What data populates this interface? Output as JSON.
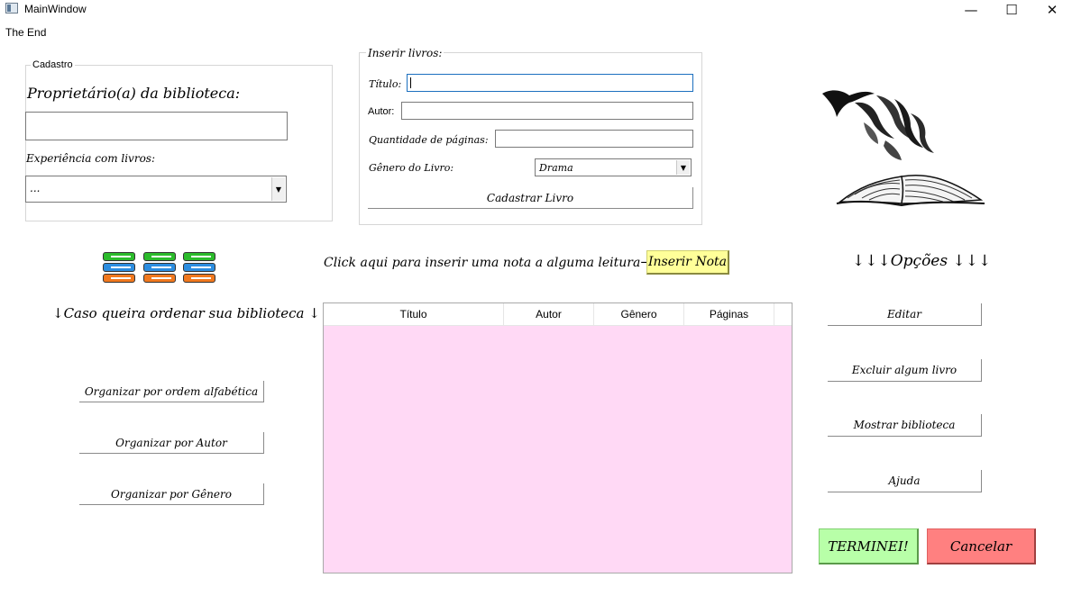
{
  "window": {
    "title": "MainWindow",
    "controls": {
      "minimize": "—",
      "maximize": "☐",
      "close": "✕"
    }
  },
  "menu": {
    "items": [
      "The End"
    ]
  },
  "cadastro": {
    "legend": "Cadastro",
    "owner_label": "Proprietário(a)  da  biblioteca:",
    "owner_value": "",
    "experience_label": "Experiência  com  livros:",
    "experience_value": "..."
  },
  "inserir": {
    "legend": "Inserir  livros:",
    "titulo_label": "Título:",
    "titulo_value": "",
    "autor_label": "Autor:",
    "autor_value": "",
    "paginas_label": "Quantidade  de  páginas:",
    "paginas_value": "",
    "genero_label": "Gênero  do  Livro:",
    "genero_value": "Drama",
    "submit_label": "Cadastrar  Livro"
  },
  "nota": {
    "prompt": "Click  aqui  para  inserir  uma  nota  a  alguma  leitura⟶",
    "button_label": "Inserir  Nota",
    "button_color": "#ffff99"
  },
  "sort": {
    "heading": "↓Caso  queira  ordenar  sua  biblioteca  ↓",
    "buttons": [
      "Organizar  por  ordem  alfabética",
      "Organizar  por  Autor",
      "Organizar  por  Gênero"
    ]
  },
  "table": {
    "columns": [
      "Título",
      "Autor",
      "Gênero",
      "Páginas"
    ],
    "rows": [],
    "background": "#ffd9f5"
  },
  "options": {
    "heading": "↓↓↓Opções  ↓↓↓",
    "buttons": [
      "Editar",
      "Excluir  algum  livro",
      "Mostrar  biblioteca",
      "Ajuda"
    ]
  },
  "actions": {
    "done_label": "TERMINEI!",
    "done_color": "#b8ffa8",
    "cancel_label": "Cancelar",
    "cancel_color": "#ff8080"
  },
  "icons": [
    "books-stack-icon",
    "open-book-birds-illustration"
  ]
}
